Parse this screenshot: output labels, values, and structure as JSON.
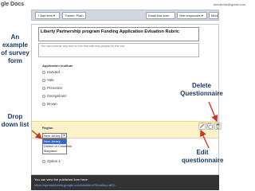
{
  "app": {
    "logo": "gle Docs",
    "user_email": "dvrobroke@gmail.com"
  },
  "toolbar": {
    "add_item": "+ Add item ▾",
    "theme": "Theme: Plain",
    "email_form": "Email this form",
    "see_responses": "See responses ▾",
    "more_actions": "More actions ▾"
  },
  "form": {
    "title": "Liberty Partnership program Funding Application Evluation Rubric",
    "description_placeholder": "You can include any text or info that will help people fill this out."
  },
  "q_institute": {
    "title": "Application Institute",
    "options": [
      "Harvard",
      "Yale",
      "Princeton",
      "Georgetown",
      "Brown"
    ]
  },
  "q_region": {
    "title": "Region",
    "selected": "New Jersey",
    "options": [
      "New Jersey",
      "District of Columbia",
      "Maryland"
    ],
    "extra_option": "Option 1"
  },
  "publish": {
    "text": "You can view the published form here:",
    "link": "https://spreadsheets.google.com/viewform?formkey=dGJ..."
  },
  "annotations": {
    "survey": "An example of survey form",
    "dropdown": "Drop down list",
    "delete": "Delete Questionnaire",
    "edit": "Edit questionnaire"
  },
  "colors": {
    "callout_text": "#17375e",
    "toolbar_bg": "#d2d8e0",
    "selected_question_bg": "#fbf2c9",
    "publish_bar_bg": "#333333",
    "dropdown_highlight": "#3366cc"
  },
  "icons": {
    "edit": "pencil-icon",
    "duplicate": "duplicate-icon",
    "delete": "trash-icon",
    "dropdown": "chevron-down-icon"
  }
}
